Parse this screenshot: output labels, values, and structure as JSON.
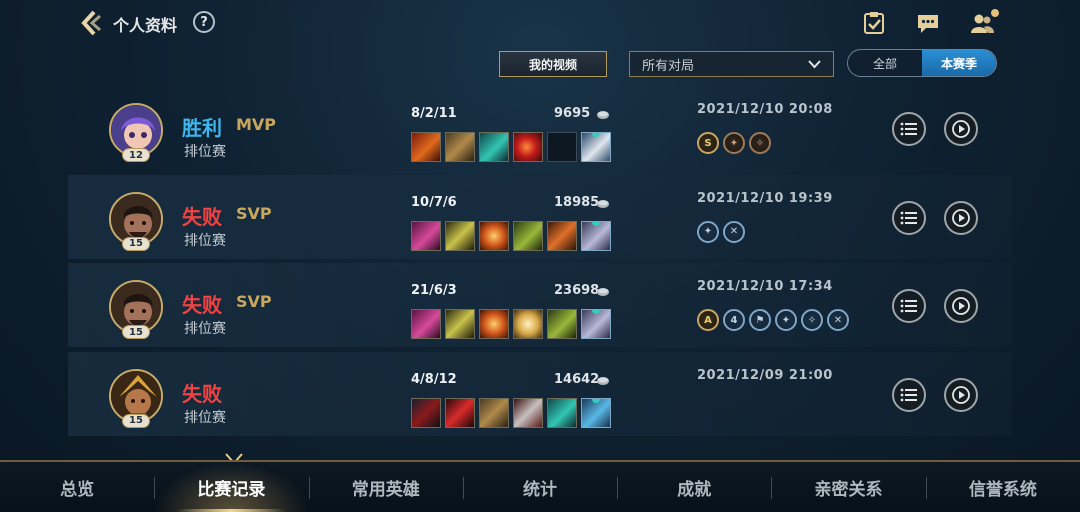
{
  "header": {
    "back_icon": "chevron-left-icon",
    "title": "个人资料",
    "help_label": "?",
    "icons": [
      "task-check-icon",
      "chat-icon",
      "friends-icon"
    ]
  },
  "filters": {
    "my_video_label": "我的视频",
    "match_type": "所有对局",
    "season_options": [
      "全部",
      "本赛季"
    ],
    "season_selected": "本赛季"
  },
  "matches": [
    {
      "result": "胜利",
      "result_type": "win",
      "tag": "MVP",
      "mode": "排位赛",
      "level": "12",
      "kda": "8/2/11",
      "gold": "9695",
      "timestamp": "2021/12/10 20:08",
      "badges": [
        "S",
        "",
        ""
      ]
    },
    {
      "result": "失败",
      "result_type": "lose",
      "tag": "SVP",
      "mode": "排位赛",
      "level": "15",
      "kda": "10/7/6",
      "gold": "18985",
      "timestamp": "2021/12/10 19:39",
      "badges": [
        "",
        ""
      ]
    },
    {
      "result": "失败",
      "result_type": "lose",
      "tag": "SVP",
      "mode": "排位赛",
      "level": "15",
      "kda": "21/6/3",
      "gold": "23698",
      "timestamp": "2021/12/10 17:34",
      "badges": [
        "A",
        "4",
        "",
        "",
        "",
        ""
      ]
    },
    {
      "result": "失败",
      "result_type": "lose",
      "tag": "",
      "mode": "排位赛",
      "level": "15",
      "kda": "4/8/12",
      "gold": "14642",
      "timestamp": "2021/12/09 21:00",
      "badges": []
    }
  ],
  "bottom_nav": {
    "tabs": [
      "总览",
      "比赛记录",
      "常用英雄",
      "统计",
      "成就",
      "亲密关系",
      "信誉系统"
    ],
    "active": "比赛记录"
  },
  "colors": {
    "win": "#3fb7ee",
    "lose": "#f24343",
    "accent_gold": "#c9a85e",
    "toggle_active": "#2a8fd3"
  }
}
